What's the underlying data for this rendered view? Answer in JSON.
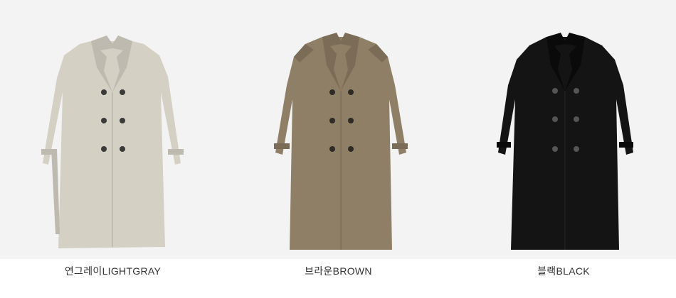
{
  "products": [
    {
      "color_label": "연그레이LIGHTGRAY",
      "coat_color": "#d4d0c4",
      "shade_color": "#bfbab0",
      "button_color": "#3a3a3a"
    },
    {
      "color_label": "브라운BROWN",
      "coat_color": "#8f7f66",
      "shade_color": "#7a6c56",
      "button_color": "#2e2a24"
    },
    {
      "color_label": "블랙BLACK",
      "coat_color": "#141414",
      "shade_color": "#0a0a0a",
      "button_color": "#555555"
    }
  ]
}
